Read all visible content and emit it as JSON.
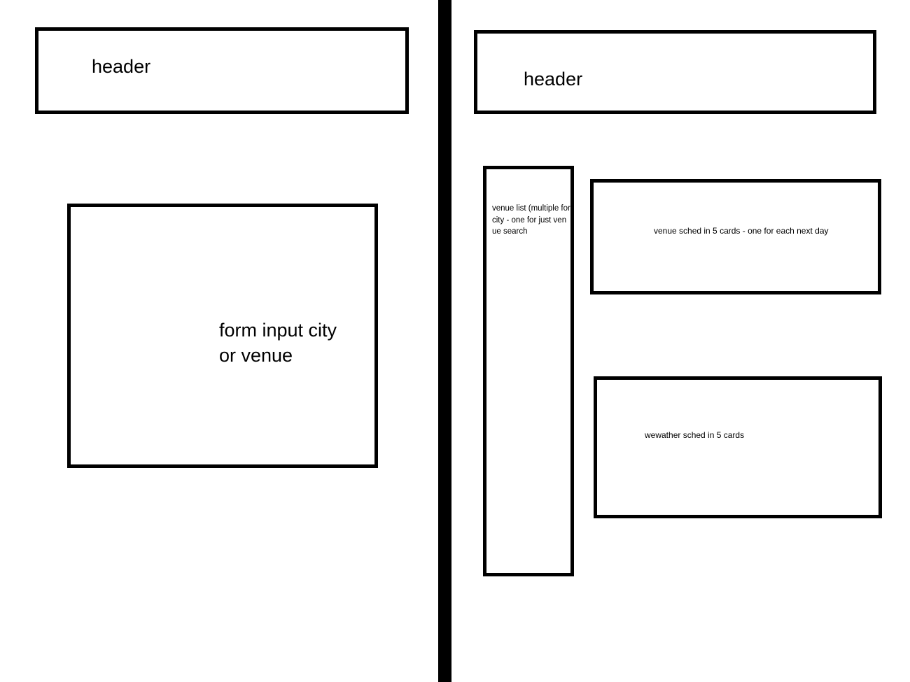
{
  "left_view": {
    "header_label": "header",
    "form_label": "form input city\nor venue"
  },
  "right_view": {
    "header_label": "header",
    "venue_list_label": "venue  list (multiple for city - one for just venue search",
    "venue_sched_label": "venue sched in 5 cards - one for each next day",
    "weather_label": "wewather sched in 5 cards"
  },
  "colors": {
    "stroke": "#000000",
    "background": "#ffffff"
  }
}
